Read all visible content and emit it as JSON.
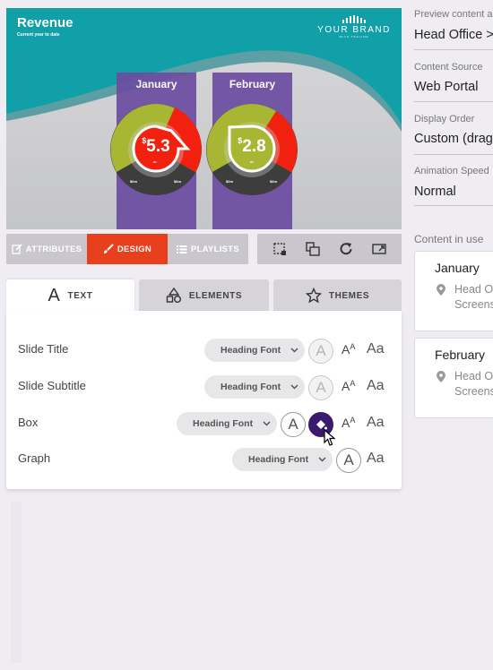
{
  "preview": {
    "title": "Revenue",
    "subtitle": "Current year to date",
    "brand_name": "YOUR BRAND",
    "brand_tagline": "WITH TAGLINE",
    "months": [
      {
        "name": "January",
        "currency": "$",
        "value": "5.3",
        "unit": "m",
        "min_label": "$0m",
        "max_label": "$6m"
      },
      {
        "name": "February",
        "currency": "$",
        "value": "2.8",
        "unit": "m",
        "min_label": "$0m",
        "max_label": "$6m"
      }
    ],
    "colors": {
      "teal": "#12a0a8",
      "purple": "#6c4ea1",
      "green": "#a8b634",
      "red": "#f2210f",
      "dark": "#3d3d3d"
    }
  },
  "tabs": [
    {
      "label": "ATTRIBUTES",
      "icon": "edit-icon"
    },
    {
      "label": "DESIGN",
      "icon": "brush-icon"
    },
    {
      "label": "PLAYLISTS",
      "icon": "list-icon"
    }
  ],
  "tools": [
    "crop-icon",
    "layers-icon",
    "refresh-icon",
    "fullscreen-icon"
  ],
  "design_tabs": [
    {
      "label": "TEXT",
      "icon": "A"
    },
    {
      "label": "ELEMENTS",
      "icon": "shapes-icon"
    },
    {
      "label": "THEMES",
      "icon": "star-icon"
    }
  ],
  "rows": [
    {
      "label": "Slide Title",
      "font": "Heading Font"
    },
    {
      "label": "Slide Subtitle",
      "font": "Heading Font"
    },
    {
      "label": "Box",
      "font": "Heading Font"
    },
    {
      "label": "Graph",
      "font": "Heading Font"
    }
  ],
  "glyphs": {
    "color": "A",
    "size": "A",
    "size_small": "A",
    "aa": "Aa"
  },
  "right": {
    "preview_label": "Preview content a",
    "preview_value": "Head Office >",
    "source_label": "Content Source",
    "source_value": "Web Portal",
    "order_label": "Display Order",
    "order_value": "Custom (drag",
    "speed_label": "Animation Speed",
    "speed_value": "Normal",
    "inuse_label": "Content in use",
    "cards": [
      {
        "title": "January",
        "line1": "Head O",
        "line2": "Screens"
      },
      {
        "title": "February",
        "line1": "Head O",
        "line2": "Screens"
      }
    ]
  }
}
